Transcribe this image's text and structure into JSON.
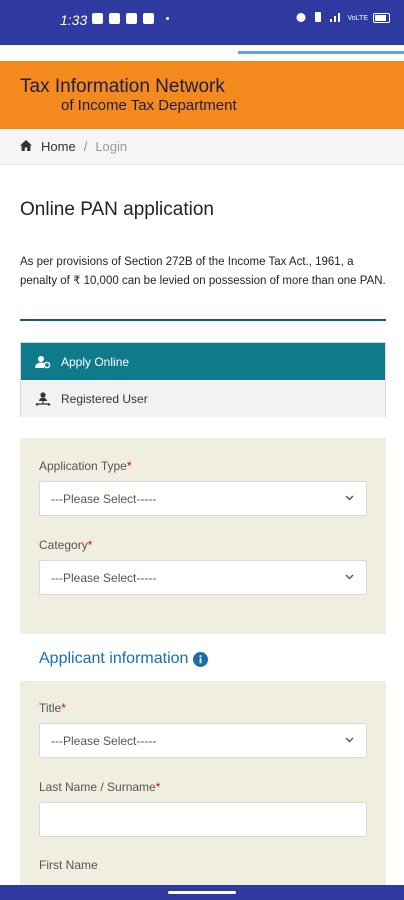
{
  "status_bar": {
    "time": "1:33",
    "network_text": "VoLTE"
  },
  "header": {
    "title": "Tax Information Network",
    "subtitle": "of Income Tax Department"
  },
  "breadcrumb": {
    "home": "Home",
    "separator": "/",
    "current": "Login"
  },
  "page": {
    "title": "Online PAN application",
    "notice": "As per provisions of Section 272B of the Income Tax Act., 1961, a penalty of ₹ 10,000 can be levied on possession of more than one PAN."
  },
  "tabs": [
    {
      "label": "Apply Online",
      "icon": "user-gear-icon",
      "active": true
    },
    {
      "label": "Registered User",
      "icon": "user-network-icon",
      "active": false
    }
  ],
  "form": {
    "required_marker": "*",
    "application_type": {
      "label": "Application Type",
      "value": "---Please Select-----"
    },
    "category": {
      "label": "Category",
      "value": "---Please Select-----"
    },
    "applicant_section": "Applicant information",
    "title": {
      "label": "Title",
      "value": "---Please Select-----"
    },
    "last_name": {
      "label": "Last Name / Surname",
      "value": ""
    },
    "first_name": {
      "label": "First Name"
    }
  },
  "colors": {
    "status_bar": "#2e3a9f",
    "header": "#f4891e",
    "active_tab": "#0f7a8c",
    "panel": "#efeee0",
    "section_heading": "#1a6fa8",
    "required": "#d0021b"
  }
}
